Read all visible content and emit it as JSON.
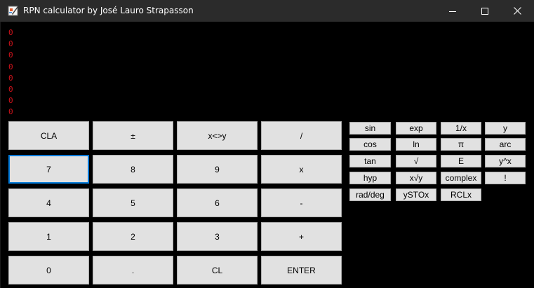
{
  "window": {
    "title": "RPN calculator by José Lauro Strapasson",
    "controls": [
      "minimize",
      "maximize",
      "close"
    ]
  },
  "stack": [
    "0",
    "0",
    "0",
    "0",
    "0",
    "0",
    "0",
    "0"
  ],
  "keypad": {
    "row1": [
      "CLA",
      "±",
      "x<>y",
      "/"
    ],
    "row2": [
      "7",
      "8",
      "9",
      "x"
    ],
    "row3": [
      "4",
      "5",
      "6",
      "-"
    ],
    "row4": [
      "1",
      "2",
      "3",
      "+"
    ],
    "row5": [
      "0",
      ".",
      "CL",
      "ENTER"
    ]
  },
  "functions": {
    "row1": [
      "sin",
      "exp",
      "1/x",
      "y"
    ],
    "row2": [
      "cos",
      "ln",
      "π",
      "arc"
    ],
    "row3": [
      "tan",
      "√",
      "E",
      "y^x"
    ],
    "row4": [
      "hyp",
      "x√y",
      "complex",
      "!"
    ],
    "row5": [
      "rad/deg",
      "ySTOx",
      "RCLx"
    ]
  },
  "focused_button": "7",
  "colors": {
    "stack_text": "#d0121b",
    "titlebar": "#2b2b2b",
    "button_face": "#e1e1e1",
    "focus_border": "#0078d7"
  }
}
